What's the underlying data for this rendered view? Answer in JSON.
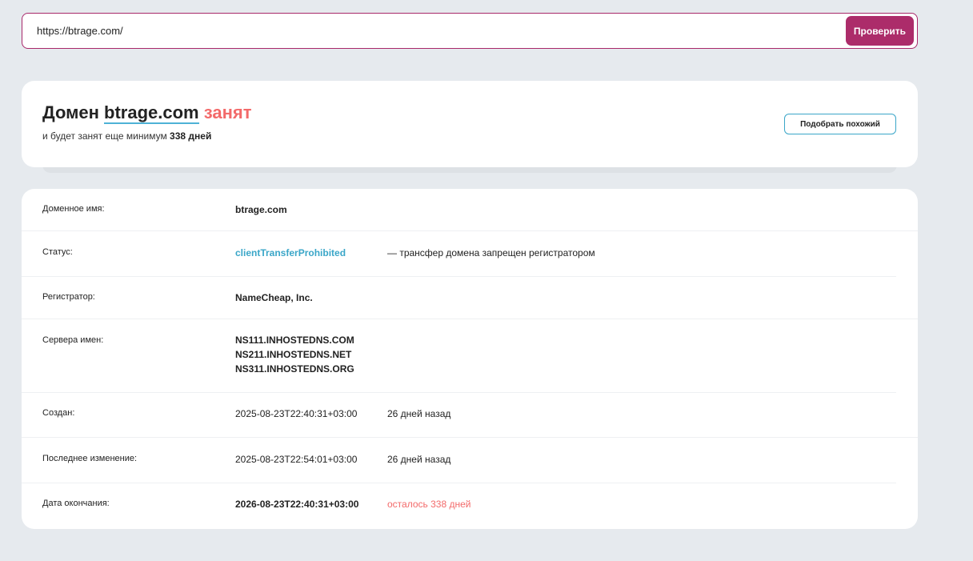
{
  "search": {
    "value": "https://btrage.com/",
    "button_label": "Проверить"
  },
  "status": {
    "prefix": "Домен",
    "domain": "btrage.com",
    "state": "занят",
    "sub_prefix": "и будет занят еще минимум",
    "sub_days": "338 дней",
    "similar_button": "Подобрать похожий",
    "colors": {
      "taken": "#f36a6a",
      "accent": "#ac2c6a",
      "link": "#3aa6c8"
    }
  },
  "info": {
    "domain_name": {
      "label": "Доменное имя:",
      "value": "btrage.com"
    },
    "status": {
      "label": "Статус:",
      "value": "clientTransferProhibited",
      "note": "— трансфер домена запрещен регистратором"
    },
    "registrar": {
      "label": "Регистратор:",
      "value": "NameCheap, Inc."
    },
    "nameservers": {
      "label": "Сервера имен:",
      "values": [
        "NS111.INHOSTEDNS.COM",
        "NS211.INHOSTEDNS.NET",
        "NS311.INHOSTEDNS.ORG"
      ]
    },
    "created": {
      "label": "Создан:",
      "value": "2025-08-23T22:40:31+03:00",
      "note": "26 дней назад"
    },
    "updated": {
      "label": "Последнее изменение:",
      "value": "2025-08-23T22:54:01+03:00",
      "note": "26 дней назад"
    },
    "expires": {
      "label": "Дата окончания:",
      "value": "2026-08-23T22:40:31+03:00",
      "note": "осталось 338 дней"
    }
  }
}
